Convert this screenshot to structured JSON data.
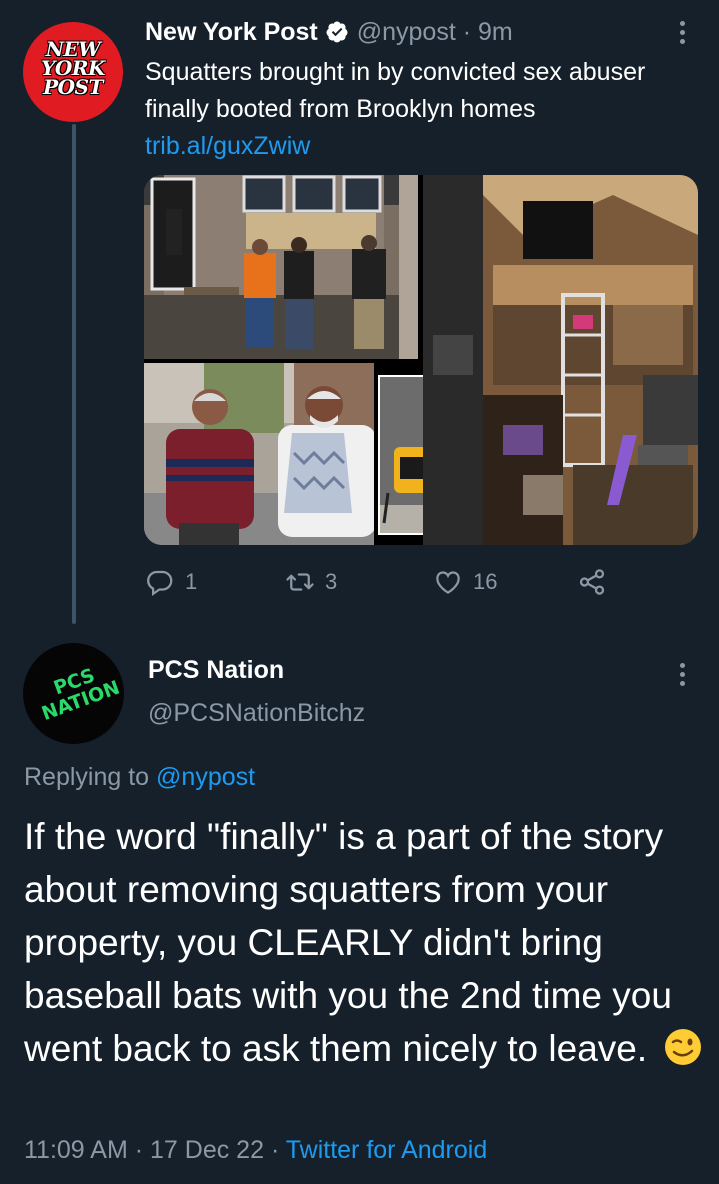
{
  "tweet": {
    "author_name": "New York Post",
    "author_handle": "@nypost",
    "time_ago": "9m",
    "separator": "·",
    "avatar_logo_lines": [
      "NEW",
      "YORK",
      "POST"
    ],
    "text": "Squatters brought in by convicted sex abuser finally booted from Brooklyn homes",
    "link": "trib.al/guxZwiw",
    "actions": {
      "replies": "1",
      "retweets": "3",
      "likes": "16"
    }
  },
  "reply": {
    "author_name": "PCS Nation",
    "author_handle": "@PCSNationBitchz",
    "avatar_logo_lines": [
      "PCS",
      "NATION"
    ],
    "replying_prefix": "Replying to",
    "replying_to": "@nypost",
    "text": "If the word \"finally\" is a part of the story about removing squatters from your property, you CLEARLY didn't bring baseball bats with you the 2nd time you went back to ask them nicely to leave.",
    "time": "11:09 AM",
    "date": "17 Dec 22",
    "source": "Twitter for Android",
    "separator": "·"
  },
  "colors": {
    "background": "#15202b",
    "text_primary": "#ffffff",
    "text_secondary": "#8b98a5",
    "accent": "#1d9bf0",
    "nyp_red": "#e11b22",
    "pcs_green": "#2bd96b"
  },
  "icons": [
    "verified-badge-icon",
    "more-options-icon",
    "reply-icon",
    "retweet-icon",
    "like-icon",
    "share-icon",
    "wink-emoji-icon"
  ]
}
